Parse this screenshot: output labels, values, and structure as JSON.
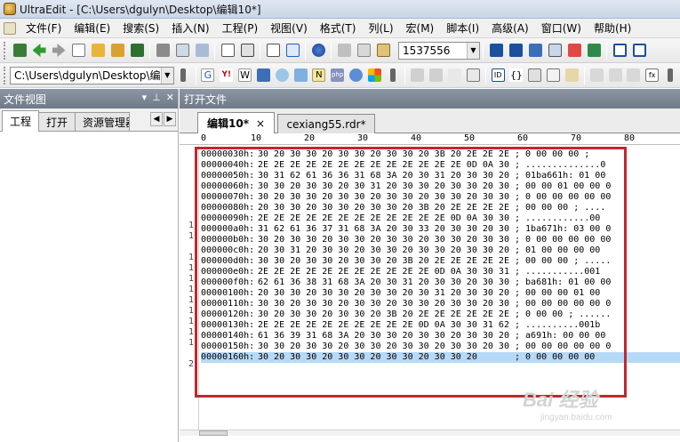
{
  "window": {
    "title": "UltraEdit - [C:\\Users\\dgulyn\\Desktop\\编辑10*]"
  },
  "menu": [
    "文件(F)",
    "编辑(E)",
    "搜索(S)",
    "插入(N)",
    "工程(P)",
    "视图(V)",
    "格式(T)",
    "列(L)",
    "宏(M)",
    "脚本(I)",
    "高级(A)",
    "窗口(W)",
    "帮助(H)"
  ],
  "toolbar": {
    "search_value": "1537556",
    "path_value": "C:\\Users\\dgulyn\\Desktop\\编辑"
  },
  "side_panel": {
    "title": "文件视图",
    "tabs": [
      "工程",
      "打开",
      "资源管理器"
    ]
  },
  "main_panel": {
    "title": "打开文件"
  },
  "doc_tabs": [
    {
      "label": "编辑10*",
      "close": "×"
    },
    {
      "label": "cexiang55.rdr*"
    }
  ],
  "ruler": [
    "0",
    "10",
    "20",
    "30",
    "40",
    "50",
    "60",
    "70",
    "80"
  ],
  "gutter_marks": [
    "1",
    "1",
    "1",
    "1",
    "1",
    "1",
    "1",
    "1",
    "1",
    "1",
    "1",
    "2"
  ],
  "hex_lines": [
    {
      "addr": "00000030h:",
      "hex": "30 20 30 30 20 30 30 20 30 30 20 3B 20 2E 2E 2E",
      "ascii": "; 0 00 00 00 ;"
    },
    {
      "addr": "00000040h:",
      "hex": "2E 2E 2E 2E 2E 2E 2E 2E 2E 2E 2E 2E 2E 0D 0A 30",
      "ascii": "; ..............0"
    },
    {
      "addr": "00000050h:",
      "hex": "30 31 62 61 36 36 31 68 3A 20 30 31 20 30 30 20",
      "ascii": "; 01ba661h: 01 00"
    },
    {
      "addr": "00000060h:",
      "hex": "30 30 20 30 30 20 30 31 20 30 30 20 30 30 20 30",
      "ascii": "; 00 00 01 00 00 0"
    },
    {
      "addr": "00000070h:",
      "hex": "30 20 30 30 20 30 30 20 30 30 20 30 30 20 30 30",
      "ascii": "; 0 00 00 00 00 00"
    },
    {
      "addr": "00000080h:",
      "hex": "20 30 30 20 30 30 20 30 30 20 3B 20 2E 2E 2E 2E",
      "ascii": "; 00 00 00 ; ...."
    },
    {
      "addr": "00000090h:",
      "hex": "2E 2E 2E 2E 2E 2E 2E 2E 2E 2E 2E 2E 0D 0A 30 30",
      "ascii": "; ............00"
    },
    {
      "addr": "000000a0h:",
      "hex": "31 62 61 36 37 31 68 3A 20 30 33 20 30 30 20 30",
      "ascii": "; 1ba671h: 03 00 0"
    },
    {
      "addr": "000000b0h:",
      "hex": "30 20 30 30 20 30 30 20 30 30 20 30 30 20 30 30",
      "ascii": "; 0 00 00 00 00 00"
    },
    {
      "addr": "000000c0h:",
      "hex": "20 30 31 20 30 30 20 30 30 20 30 30 20 30 30 20",
      "ascii": "; 01 00 00 00 00"
    },
    {
      "addr": "000000d0h:",
      "hex": "30 30 20 30 30 20 30 30 20 3B 20 2E 2E 2E 2E 2E",
      "ascii": "; 00 00 00 ; ....."
    },
    {
      "addr": "000000e0h:",
      "hex": "2E 2E 2E 2E 2E 2E 2E 2E 2E 2E 2E 0D 0A 30 30 31",
      "ascii": "; ...........001"
    },
    {
      "addr": "000000f0h:",
      "hex": "62 61 36 38 31 68 3A 20 30 31 20 30 30 20 30 30",
      "ascii": "; ba681h: 01 00 00"
    },
    {
      "addr": "00000100h:",
      "hex": "20 30 30 20 30 30 20 30 30 20 30 31 20 30 30 20",
      "ascii": "; 00 00 00 01 00"
    },
    {
      "addr": "00000110h:",
      "hex": "30 30 20 30 30 20 30 30 20 30 30 20 30 30 20 30",
      "ascii": "; 00 00 00 00 00 0"
    },
    {
      "addr": "00000120h:",
      "hex": "30 20 30 30 20 30 30 20 3B 20 2E 2E 2E 2E 2E 2E",
      "ascii": "; 0 00 00 ; ......"
    },
    {
      "addr": "00000130h:",
      "hex": "2E 2E 2E 2E 2E 2E 2E 2E 2E 2E 0D 0A 30 30 31 62",
      "ascii": "; ..........001b"
    },
    {
      "addr": "00000140h:",
      "hex": "61 36 39 31 68 3A 20 30 30 20 30 30 20 30 30 20",
      "ascii": "; a691h: 00 00 00"
    },
    {
      "addr": "00000150h:",
      "hex": "30 30 20 30 30 20 30 30 20 30 30 20 30 30 20 30",
      "ascii": "; 00 00 00 00 00 0"
    },
    {
      "addr": "00000160h:",
      "hex": "30 20 30 30 20 30 30 20 30 30 20 30 30 20",
      "ascii": "; 0 00 00 00 00"
    }
  ],
  "selected_line_index": 19,
  "watermark": {
    "brand": "Bai 经验",
    "sub": "jingyan.baidu.com"
  },
  "colors": {
    "highlight": "#c0282e",
    "selection": "#b6d9f6",
    "panel_header": "#7d8796"
  }
}
